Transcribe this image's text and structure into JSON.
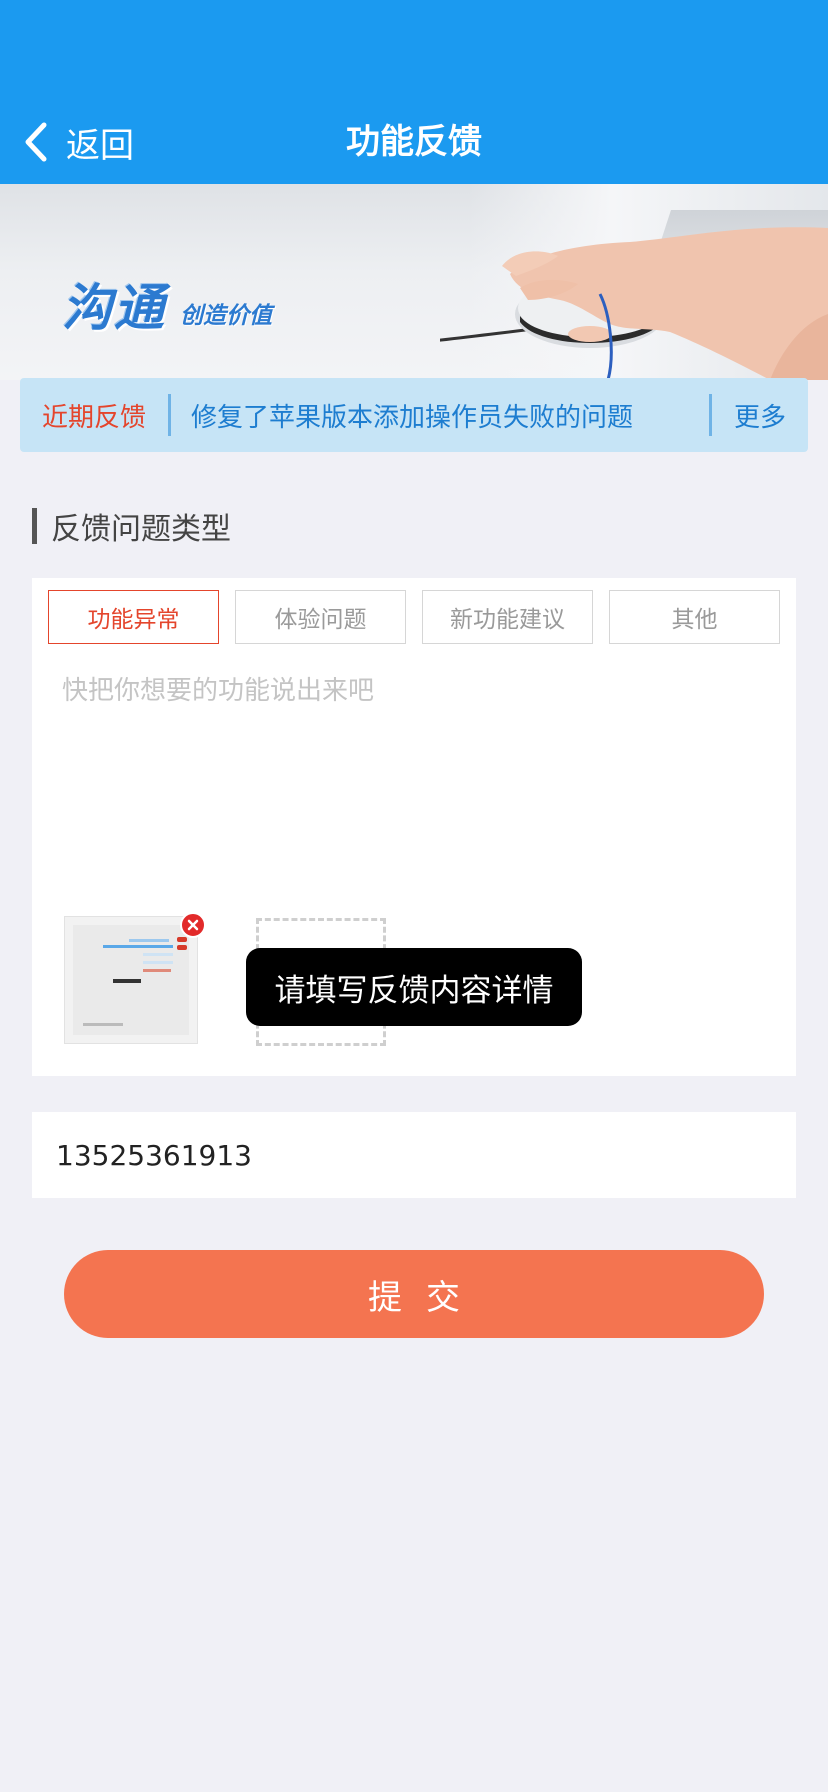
{
  "header": {
    "back_label": "返回",
    "title": "功能反馈",
    "color": "#1b9af0"
  },
  "banner": {
    "slogan_main": "沟通",
    "slogan_sub": "创造价值"
  },
  "recent": {
    "label": "近期反馈",
    "text": "修复了苹果版本添加操作员失败的问题",
    "more": "更多"
  },
  "section": {
    "title": "反馈问题类型"
  },
  "types": [
    {
      "label": "功能异常",
      "active": true
    },
    {
      "label": "体验问题",
      "active": false
    },
    {
      "label": "新功能建议",
      "active": false
    },
    {
      "label": "其他",
      "active": false
    }
  ],
  "description": {
    "placeholder": "快把你想要的功能说出来吧",
    "value": ""
  },
  "toast": {
    "message": "请填写反馈内容详情"
  },
  "phone": {
    "value": "13525361913"
  },
  "submit": {
    "label": "提交",
    "color": "#f47450"
  },
  "icons": {
    "back": "chevron-left-icon",
    "delete": "close-circle-icon"
  }
}
